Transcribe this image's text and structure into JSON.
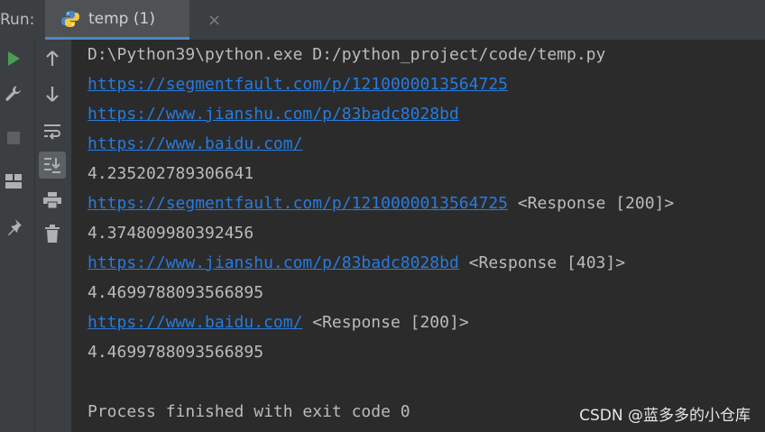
{
  "tabbar": {
    "run_label": "Run:",
    "tab_title": "temp (1)",
    "close_glyph": "×"
  },
  "toolbar_left": [
    {
      "name": "run-icon"
    },
    {
      "name": "wrench-icon"
    },
    {
      "name": "stop-icon"
    },
    {
      "name": "layout-icon"
    },
    {
      "name": "pin-icon"
    }
  ],
  "toolbar_mid": [
    {
      "name": "arrow-up-icon"
    },
    {
      "name": "arrow-down-icon"
    },
    {
      "name": "soft-wrap-icon"
    },
    {
      "name": "scroll-to-end-icon"
    },
    {
      "name": "print-icon"
    },
    {
      "name": "trash-icon"
    }
  ],
  "console": {
    "lines": [
      {
        "text": "D:\\Python39\\python.exe D:/python_project/code/temp.py"
      },
      {
        "link": "https://segmentfault.com/p/1210000013564725"
      },
      {
        "link": "https://www.jianshu.com/p/83badc8028bd"
      },
      {
        "link": "https://www.baidu.com/"
      },
      {
        "text": "4.235202789306641"
      },
      {
        "link": "https://segmentfault.com/p/1210000013564725",
        "suffix": " <Response [200]>"
      },
      {
        "text": "4.374809980392456"
      },
      {
        "link": "https://www.jianshu.com/p/83badc8028bd",
        "suffix": " <Response [403]>"
      },
      {
        "text": "4.4699788093566895"
      },
      {
        "link": "https://www.baidu.com/",
        "suffix": " <Response [200]>"
      },
      {
        "text": "4.4699788093566895"
      },
      {
        "text": ""
      },
      {
        "text": "Process finished with exit code 0"
      }
    ]
  },
  "watermark": "CSDN @蓝多多的小仓库",
  "colors": {
    "link": "#287bde",
    "run_green": "#499c54",
    "text": "#bbbbbb"
  }
}
